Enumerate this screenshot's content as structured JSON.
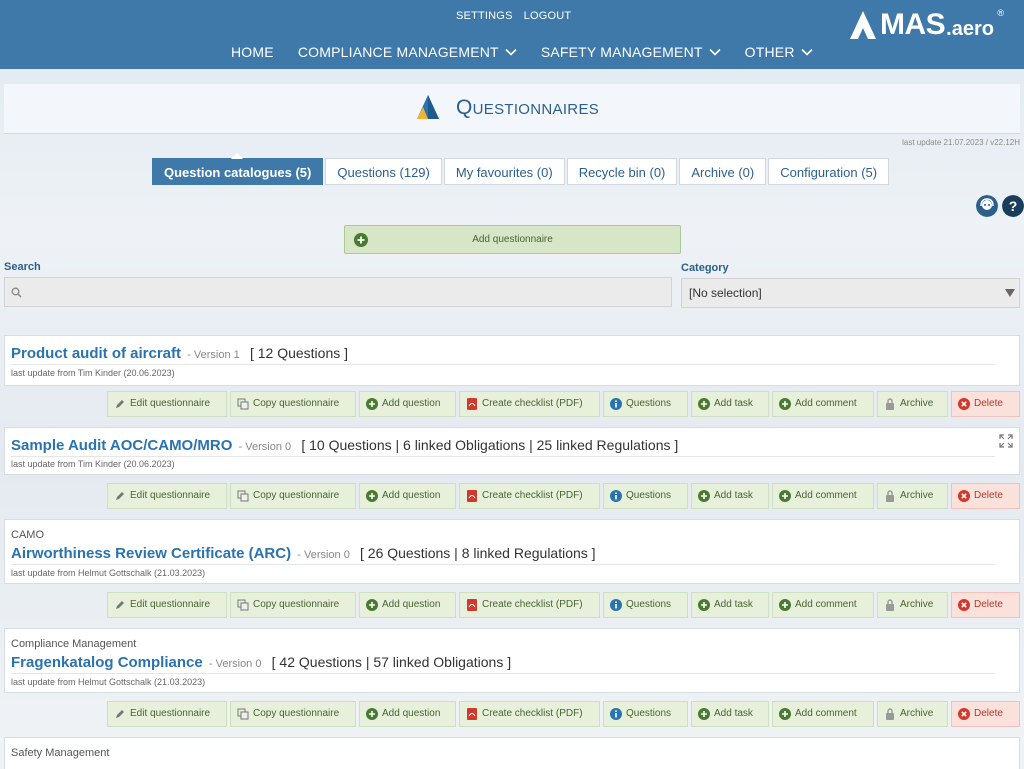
{
  "topbar": {
    "settings": "SETTINGS",
    "logout": "LOGOUT",
    "nav": [
      "HOME",
      "COMPLIANCE MANAGEMENT",
      "SAFETY MANAGEMENT",
      "OTHER"
    ],
    "logo": {
      "text": "MAS",
      "suffix": ".aero",
      "reg": "®"
    }
  },
  "page": {
    "title": "Questionnaires",
    "last_update": "last update 21.07.2023 / v22.12H"
  },
  "tabs": [
    "Question catalogues (5)",
    "Questions (129)",
    "My favourites (0)",
    "Recycle bin (0)",
    "Archive (0)",
    "Configuration (5)"
  ],
  "add_button": "Add questionnaire",
  "search": {
    "label": "Search",
    "placeholder": ""
  },
  "category": {
    "label": "Category",
    "selected": "[No selection]"
  },
  "actions": [
    "Edit questionnaire",
    "Copy questionnaire",
    "Add question",
    "Create checklist (PDF)",
    "Questions",
    "Add task",
    "Add comment",
    "Archive",
    "Delete"
  ],
  "catalogues": [
    {
      "category": "",
      "title": "Product audit of aircraft",
      "version": "- Version 1",
      "counts": "[ 12 Questions ]",
      "updated": "last update from Tim Kinder (20.06.2023)"
    },
    {
      "category": "",
      "title": "Sample Audit AOC/CAMO/MRO",
      "version": "- Version 0",
      "counts": "[ 10 Questions | 6 linked Obligations | 25 linked Regulations ]",
      "updated": "last update from Tim Kinder (20.06.2023)"
    },
    {
      "category": "CAMO",
      "title": "Airworthiness Review Certificate (ARC)",
      "version": "- Version 0",
      "counts": "[ 26 Questions | 8 linked Regulations ]",
      "updated": "last update from Helmut Gottschalk (21.03.2023)"
    },
    {
      "category": "Compliance Management",
      "title": "Fragenkatalog Compliance",
      "version": "- Version 0",
      "counts": "[ 42 Questions | 57 linked Obligations ]",
      "updated": "last update from Helmut Gottschalk (21.03.2023)"
    },
    {
      "category": "Safety Management",
      "title": "",
      "version": "",
      "counts": "",
      "updated": ""
    }
  ],
  "colors": {
    "brand": "#3f79aa",
    "action_bg": "#e6f0da",
    "delete_bg": "#fbe1dc"
  }
}
